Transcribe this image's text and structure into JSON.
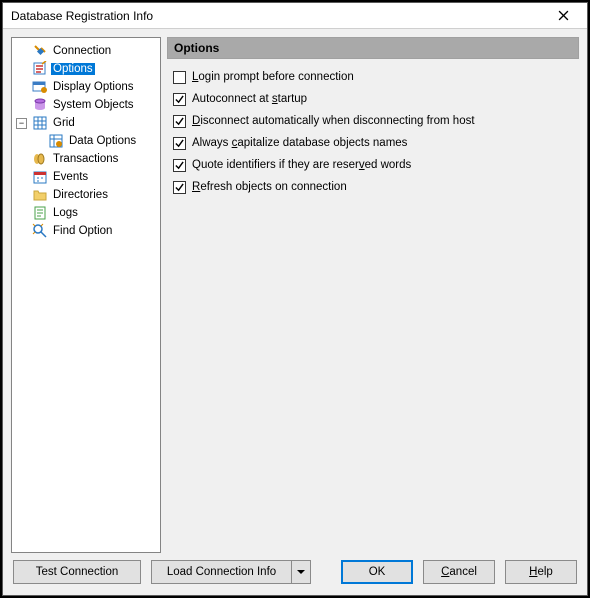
{
  "window": {
    "title": "Database Registration Info"
  },
  "tree": {
    "items": [
      {
        "id": "connection",
        "label": "Connection"
      },
      {
        "id": "options",
        "label": "Options",
        "selected": true
      },
      {
        "id": "display-options",
        "label": "Display Options"
      },
      {
        "id": "system-objects",
        "label": "System Objects"
      },
      {
        "id": "grid",
        "label": "Grid",
        "expanded": true,
        "children": [
          {
            "id": "data-options",
            "label": "Data Options"
          }
        ]
      },
      {
        "id": "transactions",
        "label": "Transactions"
      },
      {
        "id": "events",
        "label": "Events"
      },
      {
        "id": "directories",
        "label": "Directories"
      },
      {
        "id": "logs",
        "label": "Logs"
      },
      {
        "id": "find-option",
        "label": "Find Option"
      }
    ]
  },
  "options": {
    "header": "Options",
    "items": [
      {
        "id": "login-prompt",
        "label_pre": "",
        "mn": "L",
        "label_post": "ogin prompt before connection",
        "checked": false
      },
      {
        "id": "autoconnect",
        "label_pre": "Autoconnect at ",
        "mn": "s",
        "label_post": "tartup",
        "checked": true
      },
      {
        "id": "disconnect-auto",
        "label_pre": "",
        "mn": "D",
        "label_post": "isconnect automatically when disconnecting from host",
        "checked": true
      },
      {
        "id": "capitalize",
        "label_pre": "Always ",
        "mn": "c",
        "label_post": "apitalize database objects names",
        "checked": true
      },
      {
        "id": "quote-reserved",
        "label_pre": "Quote identifiers if they are reser",
        "mn": "v",
        "label_post": "ed words",
        "checked": true
      },
      {
        "id": "refresh-connect",
        "label_pre": "",
        "mn": "R",
        "label_post": "efresh objects on connection",
        "checked": true
      }
    ]
  },
  "buttons": {
    "test": "Test Connection",
    "load": "Load Connection Info",
    "ok": "OK",
    "cancel_mn": "C",
    "cancel_post": "ancel",
    "help_mn": "H",
    "help_post": "elp"
  }
}
